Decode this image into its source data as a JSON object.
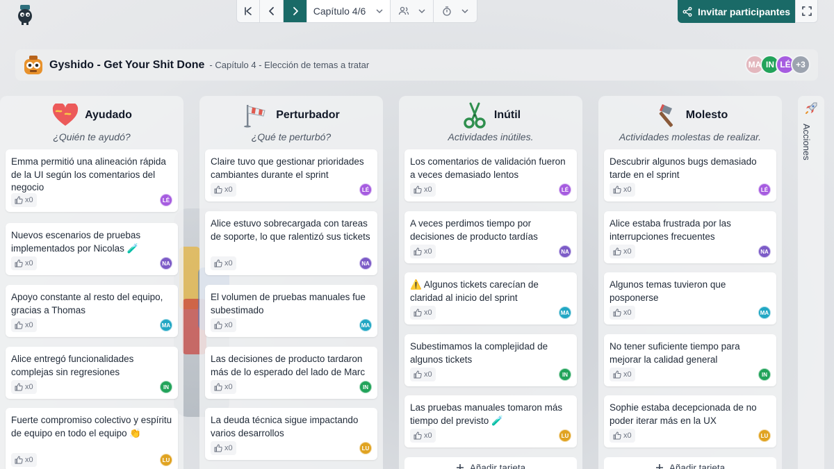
{
  "topbar": {
    "chapter_label": "Capítulo 4/6",
    "invite_label": "Invitar participantes"
  },
  "header": {
    "title": "Gyshido - Get Your Shit Done",
    "subtitle": "- Capítulo 4 - Elección de temas a tratar",
    "participants": [
      {
        "initials": "MA",
        "color": "#e3b7bd"
      },
      {
        "initials": "IN",
        "color": "#22a35a"
      },
      {
        "initials": "LÉ",
        "color": "#a65ce0"
      },
      {
        "initials": "+3",
        "color": "#9ca3af"
      }
    ]
  },
  "columns": [
    {
      "title": "Ayudado",
      "subtitle": "¿Quién te ayudó?",
      "icon": "heart-icon",
      "cards": [
        {
          "text": "Emma permitió una alineación rápida de la UI según los comentarios del negocio",
          "likes": "x0",
          "author": "LÉ"
        },
        {
          "text": "Nuevos escenarios de pruebas implementados por Nicolas 🧪",
          "likes": "x0",
          "author": "NA"
        },
        {
          "text": "Apoyo constante al resto del equipo, gracias a Thomas",
          "likes": "x0",
          "author": "MA"
        },
        {
          "text": "Alice entregó funcionalidades complejas sin regresiones",
          "likes": "x0",
          "author": "IN"
        },
        {
          "text": "Fuerte compromiso colectivo y espíritu de equipo en todo el equipo 👏",
          "likes": "x0",
          "author": "LU"
        }
      ]
    },
    {
      "title": "Perturbador",
      "subtitle": "¿Qué te perturbó?",
      "icon": "windsock-icon",
      "cards": [
        {
          "text": "Claire tuvo que gestionar prioridades cambiantes durante el sprint",
          "likes": "x0",
          "author": "LÉ"
        },
        {
          "text": "Alice estuvo sobrecargada con tareas de soporte, lo que ralentizó sus tickets",
          "likes": "x0",
          "author": "NA"
        },
        {
          "text": "El volumen de pruebas manuales fue subestimado",
          "likes": "x0",
          "author": "MA"
        },
        {
          "text": "Las decisiones de producto tardaron más de lo esperado del lado de Marc",
          "likes": "x0",
          "author": "IN"
        },
        {
          "text": "La deuda técnica sigue impactando varios desarrollos",
          "likes": "x0",
          "author": "LU"
        }
      ]
    },
    {
      "title": "Inútil",
      "subtitle": "Actividades inútiles.",
      "icon": "scissors-icon",
      "cards": [
        {
          "text": "Los comentarios de validación fueron a veces demasiado lentos",
          "likes": "x0",
          "author": "LÉ"
        },
        {
          "text": "A veces perdimos tiempo por decisiones de producto tardías",
          "likes": "x0",
          "author": "NA"
        },
        {
          "text": "⚠️ Algunos tickets carecían de claridad al inicio del sprint",
          "likes": "x0",
          "author": "MA"
        },
        {
          "text": "Subestimamos la complejidad de algunos tickets",
          "likes": "x0",
          "author": "IN"
        },
        {
          "text": "Las pruebas manuales tomaron más tiempo del previsto 🧪",
          "likes": "x0",
          "author": "LU"
        }
      ],
      "add_label": "Añadir tarjeta"
    },
    {
      "title": "Molesto",
      "subtitle": "Actividades molestas de realizar.",
      "icon": "hammer-icon",
      "cards": [
        {
          "text": "Descubrir algunos bugs demasiado tarde en el sprint",
          "likes": "x0",
          "author": "LÉ"
        },
        {
          "text": "Alice estaba frustrada por las interrupciones frecuentes",
          "likes": "x0",
          "author": "NA"
        },
        {
          "text": "Algunos temas tuvieron que posponerse",
          "likes": "x0",
          "author": "MA"
        },
        {
          "text": "No tener suficiente tiempo para mejorar la calidad general",
          "likes": "x0",
          "author": "IN"
        },
        {
          "text": "Sophie estaba decepcionada de no poder iterar más en la UX",
          "likes": "x0",
          "author": "LU"
        }
      ],
      "add_label": "Añadir tarjeta"
    }
  ],
  "author_colors": {
    "LÉ": "#a65ce0",
    "NA": "#7c5bc7",
    "MA": "#22a7c4",
    "IN": "#22a35a",
    "LU": "#e0a321"
  },
  "actions_label": "Acciones"
}
